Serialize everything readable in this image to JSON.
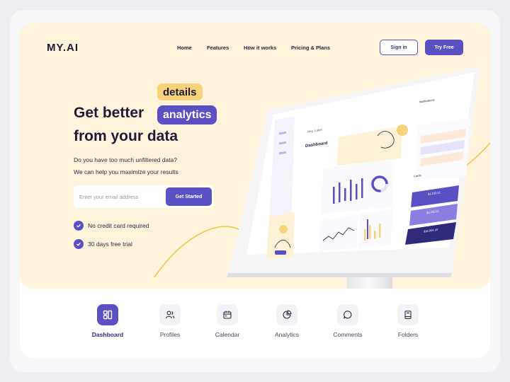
{
  "brand": {
    "logo": "MY.AI"
  },
  "nav": {
    "items": [
      "Home",
      "Features",
      "How it works",
      "Pricing & Plans"
    ],
    "signin_label": "Sign in",
    "tryfree_label": "Try Free"
  },
  "hero": {
    "tag_details": "details",
    "headline_part1": "Get better",
    "tag_analytics": "analytics",
    "headline_part2": "from your data",
    "subtitle_line1": "Do you have too much unfiltered data?",
    "subtitle_line2": "We can help you maximize your results",
    "email_placeholder": "Enter your email address",
    "cta_label": "Get Started",
    "features": [
      "No credit card required",
      "30 days free trial"
    ]
  },
  "device": {
    "dashboard_title": "Dashboard",
    "greeting": "Hey, Luke!",
    "notifications_title": "Notifications",
    "cards_title": "Cards",
    "amounts": [
      "$1,232.51",
      "$1,232.51",
      "$18,004.18"
    ]
  },
  "tabs": [
    {
      "label": "Dashboard",
      "icon": "dashboard-icon",
      "active": true
    },
    {
      "label": "Profiles",
      "icon": "profiles-icon",
      "active": false
    },
    {
      "label": "Calendar",
      "icon": "calendar-icon",
      "active": false
    },
    {
      "label": "Analytics",
      "icon": "analytics-icon",
      "active": false
    },
    {
      "label": "Comments",
      "icon": "comments-icon",
      "active": false
    },
    {
      "label": "Folders",
      "icon": "folders-icon",
      "active": false
    }
  ],
  "colors": {
    "accent": "#5b4fc4",
    "hero_bg": "#fff3dc",
    "highlight": "#f6d27a",
    "text_dark": "#1e1b3a"
  }
}
